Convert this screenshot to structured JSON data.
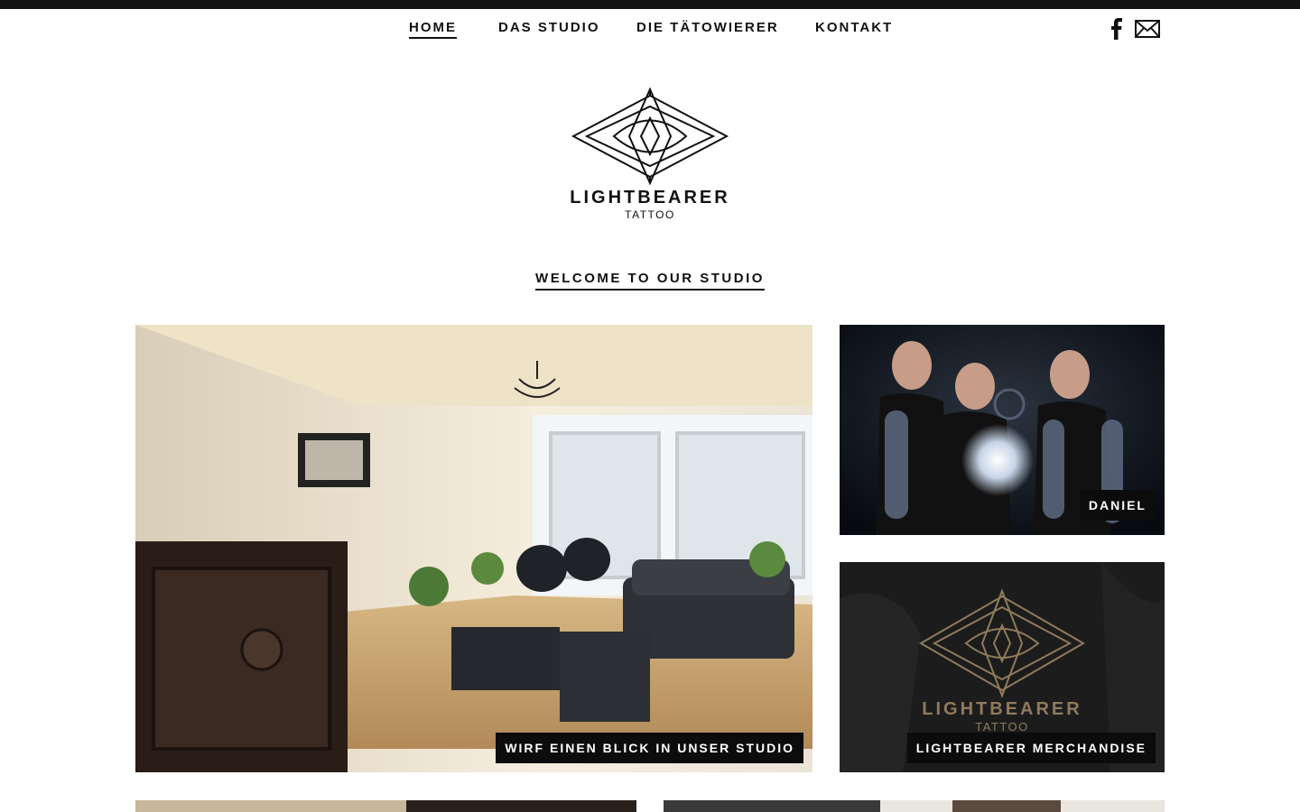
{
  "nav": {
    "items": [
      {
        "label": "HOME",
        "active": true
      },
      {
        "label": "DAS STUDIO",
        "active": false
      },
      {
        "label": "DIE TÄTOWIERER",
        "active": false
      },
      {
        "label": "KONTAKT",
        "active": false
      }
    ],
    "social_icons": [
      "facebook-icon",
      "mail-icon"
    ]
  },
  "logo": {
    "title": "LIGHTBEARER",
    "subtitle": "TATTOO"
  },
  "welcome": "WELCOME TO OUR STUDIO",
  "tiles": {
    "studio": "WIRF EINEN BLICK IN UNSER STUDIO",
    "daniel": "DANIEL",
    "merch": "LIGHTBEARER MERCHANDISE"
  },
  "merch_logo": {
    "title": "LIGHTBEARER",
    "subtitle": "TATTOO"
  },
  "colors": {
    "text": "#111111",
    "background": "#ffffff",
    "label_bg": "#0c0c0c",
    "gold": "#8f7b5c"
  }
}
